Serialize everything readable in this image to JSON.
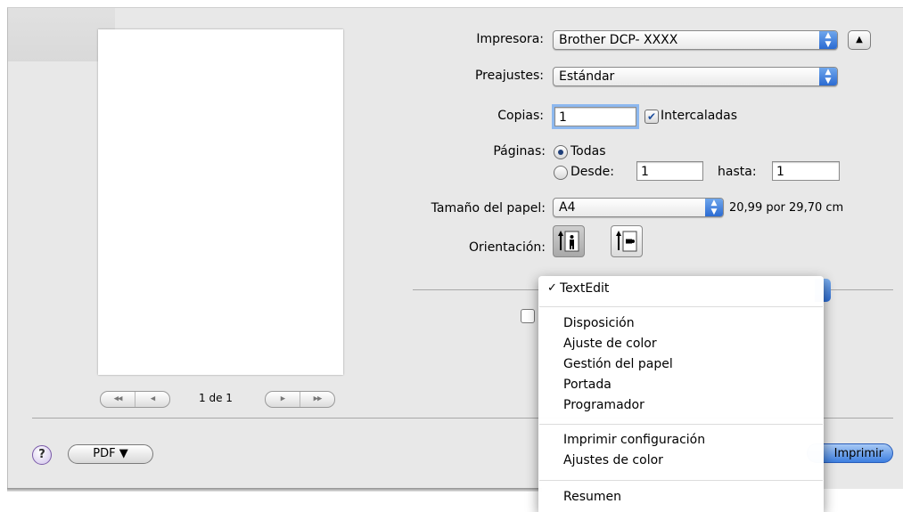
{
  "preview": {
    "page_indicator": "1 de 1",
    "nav_first": "◀◀",
    "nav_prev": "◀",
    "nav_next": "▶",
    "nav_last": "▶▶"
  },
  "form": {
    "printer_label": "Impresora:",
    "printer_value": "Brother DCP- XXXX",
    "presets_label": "Preajustes:",
    "presets_value": "Estándar",
    "copies_label": "Copias:",
    "copies_value": "1",
    "collated_label": "Intercaladas",
    "pages_label": "Páginas:",
    "pages_all_label": "Todas",
    "pages_from_label": "Desde:",
    "pages_from_value": "1",
    "pages_to_label": "hasta:",
    "pages_to_value": "1",
    "paper_size_label": "Tamaño del papel:",
    "paper_size_value": "A4",
    "paper_size_dims": "20,99 por 29,70 cm",
    "orientation_label": "Orientación:"
  },
  "buttons": {
    "help": "?",
    "pdf": "PDF ▼",
    "print": "Imprimir"
  },
  "menu": {
    "checked_mark": "✓",
    "items_group1": [
      "TextEdit"
    ],
    "items_group2": [
      "Disposición",
      "Ajuste de color",
      "Gestión del papel",
      "Portada",
      "Programador"
    ],
    "items_group3": [
      "Imprimir configuración",
      "Ajustes de color"
    ],
    "items_group4": [
      "Resumen"
    ]
  },
  "colors": {
    "accent": "#3d7fe0",
    "window_bg": "#e8e8e8"
  }
}
